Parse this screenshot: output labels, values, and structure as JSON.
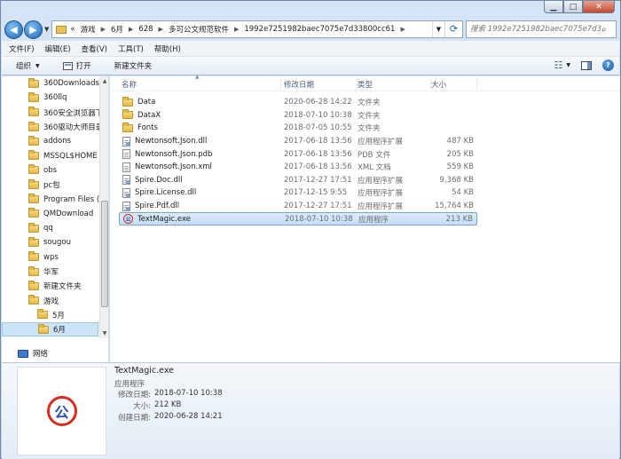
{
  "window": {
    "controls": {
      "minimize": "▁",
      "maximize": "□",
      "close": "✕"
    }
  },
  "nav": {
    "back": "◀",
    "forward": "▶",
    "breadcrumb": [
      "«",
      "游戏",
      "6月",
      "628",
      "多可公文规范软件",
      "1992e7251982baec7075e7d33800cc61"
    ],
    "search_placeholder": "搜索 1992e7251982baec7075e7d3..."
  },
  "menu": [
    "文件(F)",
    "编辑(E)",
    "查看(V)",
    "工具(T)",
    "帮助(H)"
  ],
  "toolbar": {
    "organize": "组织",
    "open": "打开",
    "new_folder": "新建文件夹"
  },
  "sidebar": {
    "items": [
      {
        "label": "360Downloads",
        "sub": false
      },
      {
        "label": "360llq",
        "sub": false
      },
      {
        "label": "360安全浏览器下",
        "sub": false
      },
      {
        "label": "360驱动大师目录",
        "sub": false
      },
      {
        "label": "addons",
        "sub": false
      },
      {
        "label": "MSSQL$HOME",
        "sub": false
      },
      {
        "label": "obs",
        "sub": false
      },
      {
        "label": "pc包",
        "sub": false
      },
      {
        "label": "Program Files (",
        "sub": false
      },
      {
        "label": "QMDownload",
        "sub": false
      },
      {
        "label": "qq",
        "sub": false
      },
      {
        "label": "sougou",
        "sub": false
      },
      {
        "label": "wps",
        "sub": false
      },
      {
        "label": "华军",
        "sub": false
      },
      {
        "label": "新建文件夹",
        "sub": false
      },
      {
        "label": "游戏",
        "sub": false
      },
      {
        "label": "5月",
        "sub": true
      },
      {
        "label": "6月",
        "sub": true,
        "selected": true
      }
    ],
    "network": "网络"
  },
  "columns": {
    "name": "名称",
    "date": "修改日期",
    "type": "类型",
    "size": "大小"
  },
  "files": [
    {
      "name": "Data",
      "date": "2020-06-28 14:22",
      "type": "文件夹",
      "size": "",
      "icon": "folder-icon"
    },
    {
      "name": "DataX",
      "date": "2018-07-10 10:38",
      "type": "文件夹",
      "size": "",
      "icon": "folder-icon"
    },
    {
      "name": "Fonts",
      "date": "2018-07-05 10:55",
      "type": "文件夹",
      "size": "",
      "icon": "folder-icon"
    },
    {
      "name": "Newtonsoft.Json.dll",
      "date": "2017-06-18 13:56",
      "type": "应用程序扩展",
      "size": "487 KB",
      "icon": "dll-icon"
    },
    {
      "name": "Newtonsoft.Json.pdb",
      "date": "2017-06-18 13:56",
      "type": "PDB 文件",
      "size": "205 KB",
      "icon": "file-icon"
    },
    {
      "name": "Newtonsoft.Json.xml",
      "date": "2017-06-18 13:56",
      "type": "XML 文档",
      "size": "559 KB",
      "icon": "file-icon"
    },
    {
      "name": "Spire.Doc.dll",
      "date": "2017-12-27 17:51",
      "type": "应用程序扩展",
      "size": "9,368 KB",
      "icon": "dll-icon"
    },
    {
      "name": "Spire.License.dll",
      "date": "2017-12-15 9:55",
      "type": "应用程序扩展",
      "size": "54 KB",
      "icon": "dll-icon"
    },
    {
      "name": "Spire.Pdf.dll",
      "date": "2017-12-27 17:51",
      "type": "应用程序扩展",
      "size": "15,764 KB",
      "icon": "dll-icon"
    },
    {
      "name": "TextMagic.exe",
      "date": "2018-07-10 10:38",
      "type": "应用程序",
      "size": "213 KB",
      "icon": "exe-icon",
      "selected": true
    }
  ],
  "details": {
    "title": "TextMagic.exe",
    "type": "应用程序",
    "logo_glyph": "公",
    "rows": [
      {
        "label": "修改日期:",
        "value": "2018-07-10 10:38"
      },
      {
        "label": "大小:",
        "value": "212 KB"
      },
      {
        "label": "创建日期:",
        "value": "2020-06-28 14:21"
      }
    ]
  }
}
